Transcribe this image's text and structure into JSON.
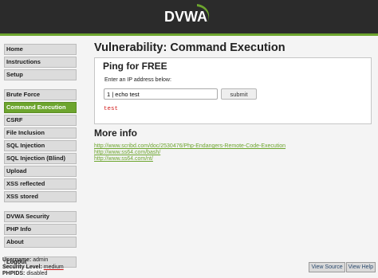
{
  "header": {
    "logo_text": "DVWA"
  },
  "menu": {
    "groups": [
      [
        "Home",
        "Instructions",
        "Setup"
      ],
      [
        "Brute Force",
        "Command Execution",
        "CSRF",
        "File Inclusion",
        "SQL Injection",
        "SQL Injection (Blind)",
        "Upload",
        "XSS reflected",
        "XSS stored"
      ],
      [
        "DVWA Security",
        "PHP Info",
        "About"
      ],
      [
        "Logout"
      ]
    ],
    "selected": "Command Execution"
  },
  "main": {
    "title": "Vulnerability: Command Execution",
    "box_title": "Ping for FREE",
    "ip_label": "Enter an IP address below:",
    "ip_value": "1 | echo test",
    "submit_label": "submit",
    "output": "test",
    "more_info_title": "More info",
    "links": [
      "http://www.scribd.com/doc/2530476/Php-Endangers-Remote-Code-Execution",
      "http://www.ss64.com/bash/",
      "http://www.ss64.com/nt/"
    ]
  },
  "footer": {
    "username_label": "Username:",
    "username": "admin",
    "security_label": "Security Level:",
    "security_level": "medium",
    "phpids_label": "PHPIDS:",
    "phpids": "disabled",
    "view_source": "View Source",
    "view_help": "View Help"
  },
  "colors": {
    "accent": "#6da52e",
    "header_bg": "#2b2b2b",
    "output": "#d21b1b"
  }
}
